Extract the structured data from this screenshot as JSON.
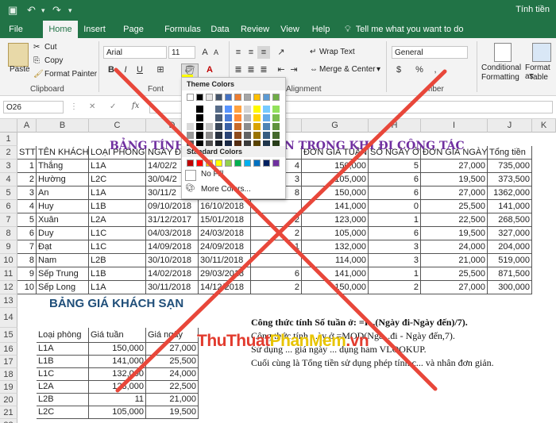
{
  "window": {
    "title_text": "Tính tiền",
    "undo_icon": "undo-icon",
    "redo_icon": "redo-icon",
    "save_icon": "save-icon"
  },
  "tabs": [
    "File",
    "Home",
    "Insert",
    "Page Layout",
    "Formulas",
    "Data",
    "Review",
    "View",
    "Help"
  ],
  "active_tab": "Home",
  "tell_me": "Tell me what you want to do",
  "ribbon": {
    "paste": "Paste",
    "cut": "Cut",
    "copy": "Copy",
    "format_painter": "Format Painter",
    "clipboard": "Clipboard",
    "font_name": "Arial",
    "font_size": "11",
    "font_group": "Font",
    "wrap_text": "Wrap Text",
    "merge_center": "Merge & Center",
    "alignment": "Alignment",
    "number_format": "General",
    "number_group": "mber",
    "conditional": "Conditional",
    "formatting": "Formatting",
    "format_as": "Format as",
    "table": "Table"
  },
  "color_panel": {
    "theme_colors": "Theme Colors",
    "standard_colors": "Standard Colors",
    "no_fill": "No Fill",
    "more_colors": "More Colors...",
    "theme_row": [
      "#ffffff",
      "#000000",
      "#e7e6e6",
      "#44546a",
      "#4472c4",
      "#ed7d31",
      "#a5a5a5",
      "#ffc000",
      "#5b9bd5",
      "#70ad47"
    ],
    "standard_row": [
      "#c00000",
      "#ff0000",
      "#ffc000",
      "#ffff00",
      "#92d050",
      "#00b050",
      "#00b0f0",
      "#0070c0",
      "#002060",
      "#7030a0"
    ]
  },
  "formula_bar": {
    "name_box": "O26",
    "cancel": "✕",
    "enter": "✓",
    "fx": "fx",
    "content": ""
  },
  "columns": [
    "A",
    "B",
    "C",
    "D",
    "E",
    "F",
    "G",
    "H",
    "I",
    "J",
    "K"
  ],
  "sheet": {
    "title": "BẢNG TÍNH TIỀN PHÒNG KHÁCH SẠN TRONG KHI ĐI CÔNG TÁC",
    "title_visible_left": "BẢNG TÍNH T",
    "title_visible_right": "N TRONG KHI ĐI CÔNG TÁC",
    "headers": [
      "STT",
      "TÊN KHÁCH",
      "LOẠI PHÒNG",
      "NGÀY Đ",
      "N Ở",
      "ĐƠN GIÁ TUẦN",
      "SỐ NGÀY Ở",
      "ĐƠN GIÁ NGÀY",
      "Tổng tiền"
    ],
    "rows": [
      [
        "1",
        "Thắng",
        "L1A",
        "14/02/2",
        "",
        "4",
        "150,000",
        "5",
        "27,000",
        "735,000"
      ],
      [
        "2",
        "Hường",
        "L2C",
        "30/04/2",
        "",
        "3",
        "105,000",
        "6",
        "19,500",
        "373,500"
      ],
      [
        "3",
        "An",
        "L1A",
        "30/11/2",
        "",
        "8",
        "150,000",
        "6",
        "27,000",
        "1362,000"
      ],
      [
        "4",
        "Huy",
        "L1B",
        "09/10/2018",
        "16/10/2018",
        "",
        "141,000",
        "0",
        "25,500",
        "141,000"
      ],
      [
        "5",
        "Xuân",
        "L2A",
        "31/12/2017",
        "15/01/2018",
        "2",
        "123,000",
        "1",
        "22,500",
        "268,500"
      ],
      [
        "6",
        "Duy",
        "L1C",
        "04/03/2018",
        "24/03/2018",
        "2",
        "105,000",
        "6",
        "19,500",
        "327,000"
      ],
      [
        "7",
        "Đạt",
        "L1C",
        "14/09/2018",
        "24/09/2018",
        "1",
        "132,000",
        "3",
        "24,000",
        "204,000"
      ],
      [
        "8",
        "Nam",
        "L2B",
        "30/10/2018",
        "30/11/2018",
        "",
        "114,000",
        "3",
        "21,000",
        "519,000"
      ],
      [
        "9",
        "Sếp Trung",
        "L1B",
        "14/02/2018",
        "29/03/2018",
        "6",
        "141,000",
        "1",
        "25,500",
        "871,500"
      ],
      [
        "10",
        "Sếp Long",
        "L1A",
        "30/11/2018",
        "14/12/2018",
        "2",
        "150,000",
        "2",
        "27,000",
        "300,000"
      ]
    ],
    "price_title": "BẢNG GIÁ KHÁCH SẠN",
    "price_headers": [
      "Loại phòng",
      "Giá tuần",
      "Giá ngày"
    ],
    "price_rows": [
      [
        "L1A",
        "150,000",
        "27,000"
      ],
      [
        "L1B",
        "141,000",
        "25,500"
      ],
      [
        "L1C",
        "132,000",
        "24,000"
      ],
      [
        "L2A",
        "123,000",
        "22,500"
      ],
      [
        "L2B",
        "11",
        "21,000"
      ],
      [
        "L2C",
        "105,000",
        "19,500"
      ]
    ],
    "notes": [
      "Công thức tính Số tuần ở: =I...(Ngày đi-Ngày đến)/7).",
      "Công thức tính ...ày ở =MOD(Ngà...đi - Ngày đến,7).",
      "Sử dụng ... giá ngày ... dụng hàm VLOOKUP.",
      "Cuối cùng là Tổng tiền sử dụng phép tính c... và nhân đơn giản."
    ]
  },
  "watermark": {
    "part1": "ThuThuat",
    "part2": "PhanMem",
    "part3": ".vn"
  },
  "overlay": {
    "cross_color": "#e8473a"
  }
}
